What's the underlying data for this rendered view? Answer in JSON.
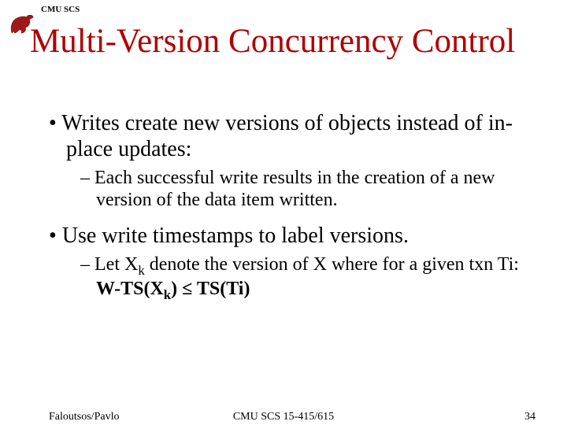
{
  "header": {
    "label": "CMU SCS"
  },
  "title": "Multi-Version Concurrency Control",
  "bullets": [
    {
      "text": "Writes create new versions of objects instead of in-place updates:",
      "sub": "Each successful write results in the creation of a new version of the data item written."
    },
    {
      "text": "Use write timestamps to label versions.",
      "sub_prefix": "Let X",
      "sub_mid1": " denote the version of X where for a given txn Ti: ",
      "sub_bold1": "W-TS(X",
      "sub_bold2": ") ≤ TS(Ti)",
      "k": "k"
    }
  ],
  "footer": {
    "left": "Faloutsos/Pavlo",
    "center": "CMU SCS 15-415/615",
    "right": "34"
  }
}
